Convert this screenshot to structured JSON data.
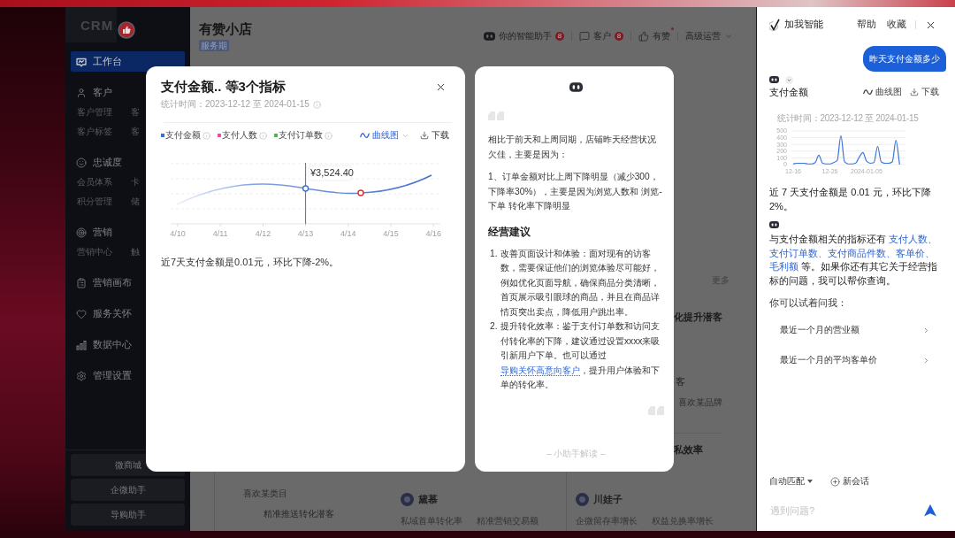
{
  "sidebar": {
    "logo": "CRM",
    "nav": [
      {
        "label": "工作台",
        "selected": true
      },
      {
        "label": "客户",
        "selected": false,
        "links": [
          "客户管理",
          "客",
          "客户标签",
          "客"
        ]
      },
      {
        "label": "忠诚度",
        "selected": false,
        "links": [
          "会员体系",
          "卡",
          "积分管理",
          "储"
        ]
      },
      {
        "label": "营销",
        "selected": false,
        "links": [
          "营销中心",
          "触"
        ]
      },
      {
        "label": "营销画布",
        "selected": false
      },
      {
        "label": "服务关怀",
        "selected": false
      },
      {
        "label": "数据中心",
        "selected": false
      },
      {
        "label": "管理设置",
        "selected": false
      }
    ],
    "buttons": [
      "微商城",
      "企微助手",
      "导购助手"
    ]
  },
  "header": {
    "title": "有赞小店",
    "tags": [
      "服务期"
    ],
    "nav": [
      {
        "label": "你的智能助手",
        "badge": "8",
        "dot": false,
        "dropdown": false
      },
      {
        "label": "客户",
        "badge": "8",
        "dot": false,
        "dropdown": false
      },
      {
        "label": "有赞",
        "dot": true,
        "dropdown": false
      },
      {
        "label": "高级运营",
        "dot": false,
        "dropdown": true
      }
    ]
  },
  "dashboard": {
    "more": "更多",
    "side_card": {
      "title": "化提升潜客",
      "line": "客",
      "tag": "喜欢某品牌",
      "footer": "私效率"
    },
    "cards": [
      {
        "kind": "segment",
        "tag": "喜欢某类目",
        "title": "精准推送转化潜客"
      },
      {
        "kind": "brand",
        "name": "黛慕",
        "metrics": [
          "私域首单转化率",
          "精准营销交易额"
        ]
      },
      {
        "kind": "brand",
        "name": "川娃子",
        "metrics": [
          "企微留存率增长",
          "权益兑换率增长"
        ]
      }
    ]
  },
  "metric_modal": {
    "title": "支付金额.. 等3个指标",
    "period": "统计时间：2023-12-12 至 2024-01-15",
    "legend": [
      {
        "label": "支付金额",
        "color": "#3c6fd4"
      },
      {
        "label": "支付人数",
        "color": "#e84fa5"
      },
      {
        "label": "支付订单数",
        "color": "#52b152"
      }
    ],
    "chart_type": "曲线图",
    "download": "下载",
    "x_labels": [
      "4/10",
      "4/11",
      "4/12",
      "4/13",
      "4/14",
      "4/15",
      "4/16"
    ],
    "tooltip": "¥3,524.40",
    "summary": "近7天支付金额是0.01元，环比下降-2%。"
  },
  "insight_modal": {
    "paragraphs": [
      "相比于前天和上周同期，店铺昨天经营状况欠佳，主要是因为：",
      "1、订单金额对比上周下降明显（减少300，下降率30%），主要是因为浏览人数和 浏览-下单 转化率下降明显"
    ],
    "heading": "经营建议",
    "advice": [
      {
        "number": "1.",
        "parts": [
          {
            "kind": "text",
            "text": "改善页面设计和体验：面对现有的访客数，需要保证他们的浏览体验尽可能好，例如优化页面导航，确保商品分类清晰，首页展示吸引眼球的商品，并且在商品详情页突出卖点，降低用户跳出率。"
          }
        ]
      },
      {
        "number": "2.",
        "parts": [
          {
            "kind": "text",
            "text": "提升转化效率：鉴于支付订单数和访问支付转化率的下降，建议通过设置xxxx来吸引新用户下单。也可以通过"
          },
          {
            "kind": "link",
            "text": "导购关怀高意向客户"
          },
          {
            "kind": "text",
            "text": "，提升用户体验和下单的转化率。"
          }
        ]
      }
    ],
    "footer": "– 小助手解读 –"
  },
  "assistant": {
    "brand": "加我智能",
    "actions": [
      "帮助",
      "收藏"
    ],
    "messages": [
      {
        "kind": "user",
        "text": "昨天支付金额多少"
      },
      {
        "kind": "chart",
        "expandable": true,
        "title": "支付金额",
        "chart_type": "曲线图",
        "download": "下载",
        "period": "统计时间：2023-12-12 至 2024-01-15",
        "chart_data": {
          "type": "line",
          "categories": [
            "12-16",
            null,
            null,
            null,
            null,
            null,
            null,
            null,
            null,
            null,
            "12-26",
            null,
            null,
            null,
            null,
            null,
            null,
            null,
            null,
            null,
            "2024-01-05",
            null,
            null,
            null,
            null,
            null,
            null,
            null,
            null,
            null
          ],
          "series": [
            {
              "color": "#3d74d9",
              "values": [
                10,
                20,
                20,
                20,
                10,
                10,
                30,
                140,
                20,
                10,
                10,
                30,
                60,
                430,
                40,
                10,
                10,
                20,
                110,
                180,
                50,
                20,
                30,
                270,
                40,
                20,
                20,
                40,
                360,
                0
              ]
            }
          ],
          "ylim": [
            0,
            500
          ],
          "yticks": [
            0,
            100,
            200,
            300,
            400,
            500
          ],
          "grid": true
        },
        "summary": "近 7 天支付金额是 0.01 元，环比下降 2%。"
      },
      {
        "kind": "text",
        "expandable": false,
        "parts": [
          {
            "kind": "text",
            "text": "与支付金额相关的指标还有 "
          },
          {
            "kind": "link",
            "text": "支付人数"
          },
          {
            "kind": "accent",
            "text": "、"
          },
          {
            "kind": "link",
            "text": "支付订单数"
          },
          {
            "kind": "accent",
            "text": "、"
          },
          {
            "kind": "link",
            "text": "支付商品件数"
          },
          {
            "kind": "accent",
            "text": "、"
          },
          {
            "kind": "link",
            "text": "客单价"
          },
          {
            "kind": "accent",
            "text": "、"
          },
          {
            "kind": "link",
            "text": "毛利额"
          },
          {
            "kind": "text",
            "text": " 等。如果你还有其它关于经营指标的问题，我可以帮你查询。"
          }
        ]
      }
    ],
    "prompt": "你可以试着问我：",
    "suggestions": [
      "最近一个月的营业额",
      "最近一个月的平均客单价"
    ],
    "mode": "自动匹配",
    "new_chat": "新会话",
    "input": {
      "placeholder": "遇到问题?"
    }
  }
}
